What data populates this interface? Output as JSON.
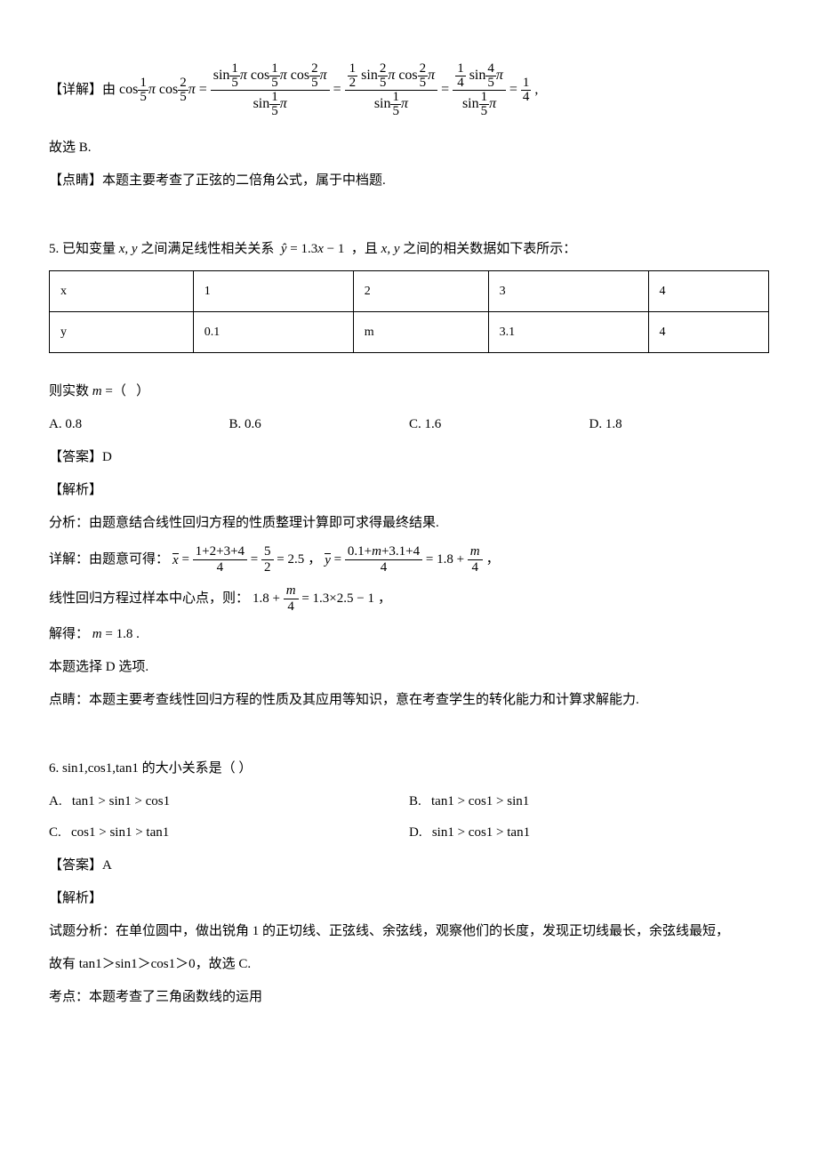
{
  "q4": {
    "detail_prefix": "【详解】由",
    "eq": "cos (1/5)π cos (2/5)π = [sin(1/5)π cos(1/5)π cos(2/5)π] / sin(1/5)π = [(1/2) sin(2/5)π cos(2/5)π] / sin(1/5)π = [(1/4) sin(4/5)π] / sin(1/5)π = 1/4 ,",
    "conclude": "故选 B.",
    "note": "【点睛】本题主要考查了正弦的二倍角公式，属于中档题."
  },
  "q5": {
    "stem_a": "5. 已知变量",
    "stem_b": "之间满足线性相关关系",
    "stem_eq": "ŷ = 1.3x − 1",
    "stem_c": "，且",
    "stem_d": "之间的相关数据如下表所示：",
    "xy": "x, y",
    "table": {
      "r1": [
        "x",
        "1",
        "2",
        "3",
        "4"
      ],
      "r2": [
        "y",
        "0.1",
        "m",
        "3.1",
        "4"
      ]
    },
    "then": "则实数",
    "m_eq": "m = （   ）",
    "choices": {
      "A": "A.  0.8",
      "B": "B.  0.6",
      "C": "C.  1.6",
      "D": "D.  1.8"
    },
    "ans": "【答案】D",
    "jiexi": "【解析】",
    "fenxi": "分析：由题意结合线性回归方程的性质整理计算即可求得最终结果.",
    "xiangjie_a": "详解：由题意可得：",
    "xbar_eq": "x̄ = (1+2+3+4)/4 = 5/2 = 2.5",
    "ybar_eq": "ȳ = (0.1+m+3.1+4)/4 = 1.8 + m/4",
    "line2_a": "线性回归方程过样本中心点，则：",
    "line2_eq": "1.8 + m/4 = 1.3×2.5 − 1",
    "line2_b": "，",
    "solve": "解得：",
    "solve_eq": "m = 1.8",
    "solve_dot": ".",
    "pick": "本题选择 D 选项.",
    "dianjing": "点睛：本题主要考查线性回归方程的性质及其应用等知识，意在考查学生的转化能力和计算求解能力."
  },
  "q6": {
    "stem": "6.  sin1,cos1,tan1 的大小关系是（  ）",
    "A": "A.   tan1 > sin1 > cos1",
    "B": "B.   tan1 > cos1 > sin1",
    "C": "C.   cos1 > sin1 > tan1",
    "D": "D.   sin1 > cos1 > tan1",
    "ans": "【答案】A",
    "jiexi": "【解析】",
    "fenxi1": "试题分析：在单位圆中，做出锐角 1 的正切线、正弦线、余弦线，观察他们的长度，发现正切线最长，余弦线最短，",
    "fenxi2": "故有 tan1＞sin1＞cos1＞0，故选 C.",
    "kaodian": "考点：本题考查了三角函数线的运用"
  }
}
